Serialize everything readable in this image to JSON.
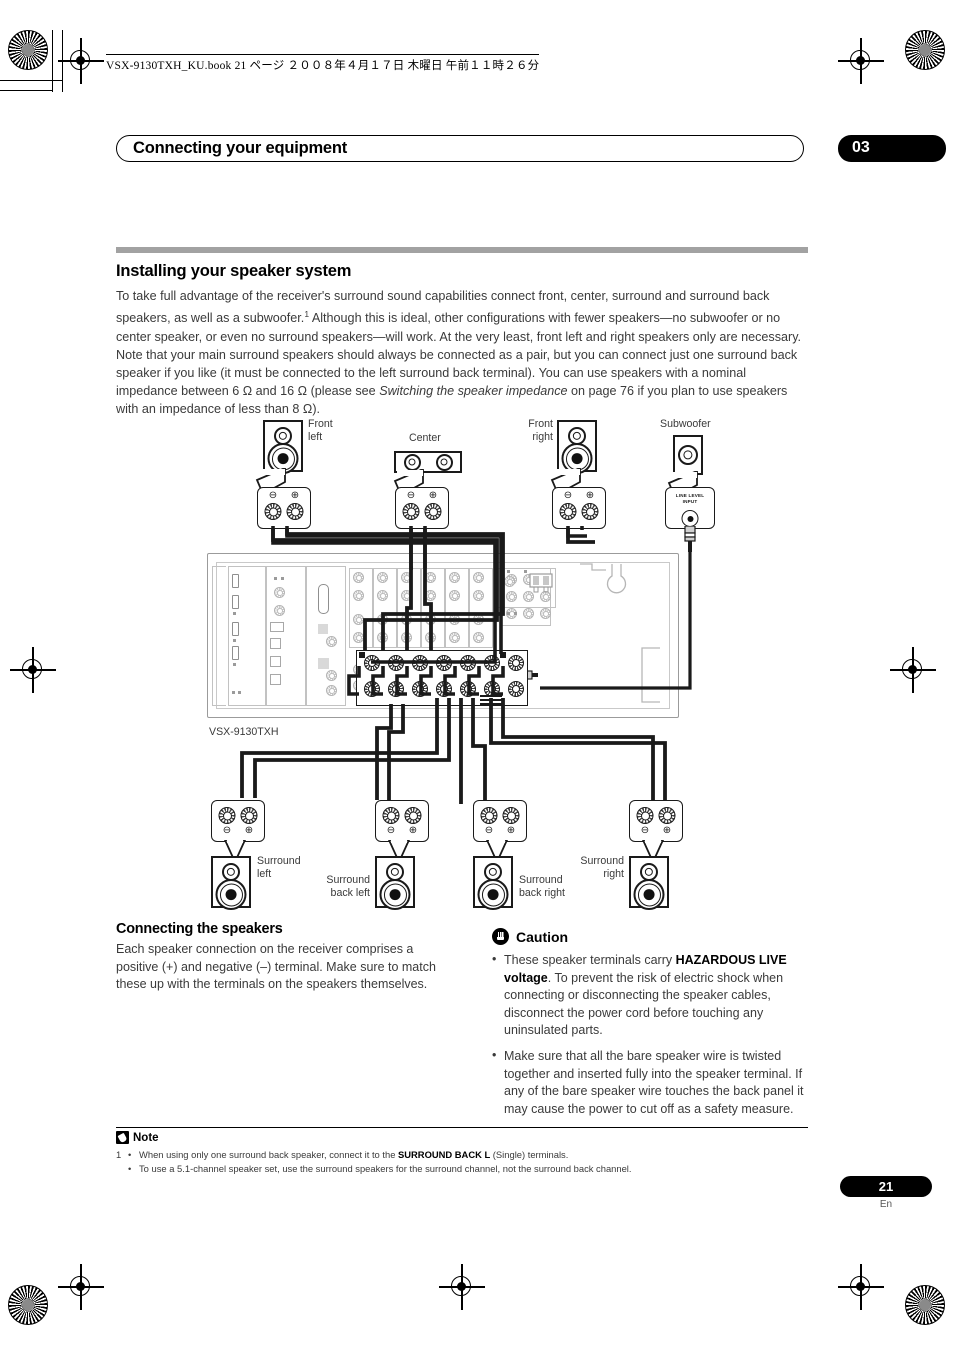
{
  "print_header": {
    "file_line": "VSX-9130TXH_KU.book   21 ページ   ２００８年４月１７日   木曜日   午前１１時２６分"
  },
  "chapter": {
    "title": "Connecting your equipment",
    "number": "03"
  },
  "section": {
    "heading": "Installing your speaker system",
    "body_part1": "To take full advantage of the receiver's surround sound capabilities connect front, center, surround and surround back speakers, as well as a subwoofer.",
    "footnote_marker": "1",
    "body_part2": " Although this is ideal, other configurations with fewer speakers—no subwoofer or no center speaker, or even no surround speakers—will work. At the very least, front left and right speakers only are necessary. Note that your main surround speakers should always be connected as a pair, but you can connect just one surround back speaker if you like (it must be connected to the left surround back terminal). You can use speakers with a nominal impedance between 6 Ω and 16 Ω (please see ",
    "body_italic": "Switching the speaker impedance",
    "body_part3": " on page 76 if you plan to use speakers with an impedance of less than 8 Ω)."
  },
  "diagram": {
    "model_label": "VSX-9130TXH",
    "line_level_input": "LINE LEVEL\nINPUT",
    "minus_symbol": "⊖",
    "plus_symbol": "⊕",
    "speakers_top": [
      {
        "id": "front-left",
        "label": "Front\nleft"
      },
      {
        "id": "center",
        "label": "Center"
      },
      {
        "id": "front-right",
        "label": "Front\nright"
      },
      {
        "id": "subwoofer",
        "label": "Subwoofer"
      }
    ],
    "speakers_bottom": [
      {
        "id": "surround-left",
        "label": "Surround\nleft"
      },
      {
        "id": "surround-back-left",
        "label": "Surround\nback left"
      },
      {
        "id": "surround-back-right",
        "label": "Surround\nback right"
      },
      {
        "id": "surround-right",
        "label": "Surround\nright"
      }
    ]
  },
  "connecting_speakers": {
    "heading": "Connecting the speakers",
    "body": "Each speaker connection on the receiver comprises a positive (+) and negative (–) terminal. Make sure to match these up with the terminals on the speakers themselves."
  },
  "caution": {
    "title": "Caution",
    "bullet1_pre": "These speaker terminals carry ",
    "bullet1_bold": "HAZARDOUS LIVE voltage",
    "bullet1_post": ". To prevent the risk of electric shock when connecting or disconnecting the speaker cables, disconnect the power cord before touching any uninsulated parts.",
    "bullet2": "Make sure that all the bare speaker wire is twisted together and inserted fully into the speaker terminal. If any of the bare speaker wire touches the back panel it may cause the power to cut off as a safety measure."
  },
  "note": {
    "title": "Note",
    "index": "1",
    "bullet_char": "•",
    "line1_pre": "When using only one surround back speaker, connect it to the ",
    "line1_bold": "SURROUND BACK L",
    "line1_post": " (Single) terminals.",
    "line2": "To use a 5.1-channel speaker set, use the surround speakers for the surround channel, not the surround back channel."
  },
  "footer": {
    "page_number": "21",
    "language": "En"
  },
  "colors": {
    "rule_gray": "#a2a2a2",
    "text_gray": "#3a3a3a",
    "black": "#000000"
  }
}
